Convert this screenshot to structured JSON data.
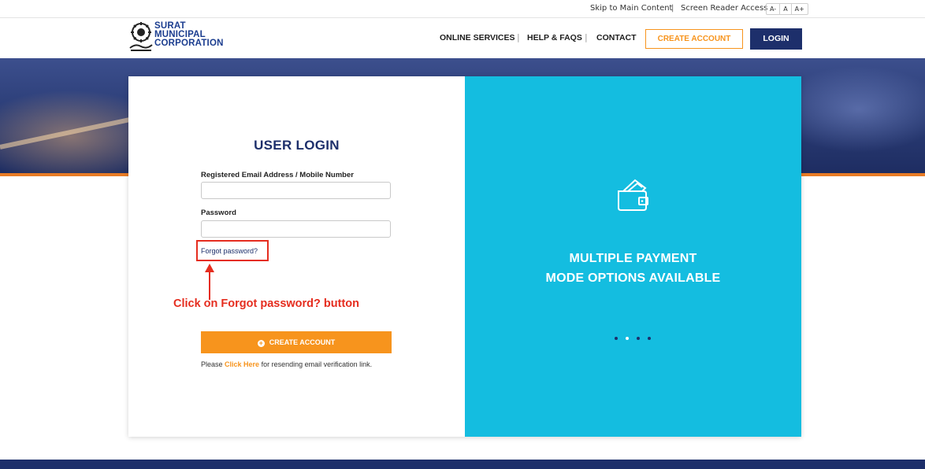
{
  "topbar": {
    "skip_link": "Skip to Main Content",
    "separator": "|",
    "screen_reader": "Screen Reader Access",
    "font_sizes": [
      "A-",
      "A",
      "A+"
    ]
  },
  "header": {
    "logo_lines": [
      "SURAT",
      "MUNICIPAL",
      "CORPORATION"
    ],
    "nav": {
      "online_services": "ONLINE SERVICES",
      "help_faqs": "HELP & FAQS",
      "contact": "CONTACT",
      "separator": "|"
    },
    "create_account": "CREATE ACCOUNT",
    "login": "LOGIN"
  },
  "login_form": {
    "title": "USER LOGIN",
    "email_label": "Registered Email Address / Mobile Number",
    "email_value": "",
    "password_label": "Password",
    "password_value": "",
    "forgot_password": "Forgot password?",
    "create_account": "CREATE ACCOUNT",
    "create_icon": "+",
    "resend_prefix": "Please ",
    "resend_link": "Click Here",
    "resend_suffix": " for resending email verification link."
  },
  "annotation": {
    "text": "Click on Forgot password? button"
  },
  "promo": {
    "line1": "MULTIPLE PAYMENT",
    "line2": "MODE OPTIONS AVAILABLE",
    "icon": "wallet-icon",
    "slide_count": 4,
    "active_slide": 2
  },
  "colors": {
    "navy": "#1d2f6b",
    "orange": "#f7941d",
    "cyan": "#14bde0",
    "annotation_red": "#e52d1f"
  }
}
